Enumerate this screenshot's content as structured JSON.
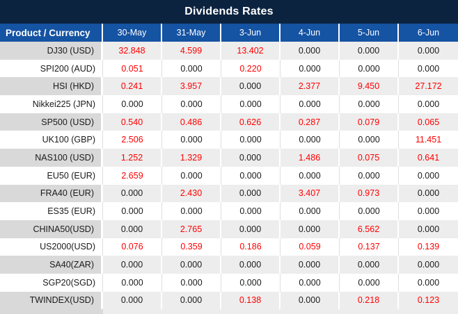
{
  "title": "Dividends Rates",
  "colors": {
    "title_bar_bg": "#0C2340",
    "header_bg": "#1553A3",
    "header_text": "#FFFFFF",
    "row_alt_product_bg": "#D9D9D9",
    "row_alt_value_bg": "#EDEDED",
    "row_white_bg": "#FFFFFF",
    "value_default": "#1A1A1A",
    "value_highlight": "#FF0000"
  },
  "table": {
    "product_column_header": "Product / Currency",
    "date_columns": [
      "30-May",
      "31-May",
      "3-Jun",
      "4-Jun",
      "5-Jun",
      "6-Jun"
    ],
    "rows": [
      {
        "product": "DJ30 (USD)",
        "values": [
          "32.848",
          "4.599",
          "13.402",
          "0.000",
          "0.000",
          "0.000"
        ],
        "highlight": [
          true,
          true,
          true,
          false,
          false,
          false
        ]
      },
      {
        "product": "SPI200 (AUD)",
        "values": [
          "0.051",
          "0.000",
          "0.220",
          "0.000",
          "0.000",
          "0.000"
        ],
        "highlight": [
          true,
          false,
          true,
          false,
          false,
          false
        ]
      },
      {
        "product": "HSI (HKD)",
        "values": [
          "0.241",
          "3.957",
          "0.000",
          "2.377",
          "9.450",
          "27.172"
        ],
        "highlight": [
          true,
          true,
          false,
          true,
          true,
          true
        ]
      },
      {
        "product": "Nikkei225 (JPN)",
        "values": [
          "0.000",
          "0.000",
          "0.000",
          "0.000",
          "0.000",
          "0.000"
        ],
        "highlight": [
          false,
          false,
          false,
          false,
          false,
          false
        ]
      },
      {
        "product": "SP500 (USD)",
        "values": [
          "0.540",
          "0.486",
          "0.626",
          "0.287",
          "0.079",
          "0.065"
        ],
        "highlight": [
          true,
          true,
          true,
          true,
          true,
          true
        ]
      },
      {
        "product": "UK100 (GBP)",
        "values": [
          "2.506",
          "0.000",
          "0.000",
          "0.000",
          "0.000",
          "11.451"
        ],
        "highlight": [
          true,
          false,
          false,
          false,
          false,
          true
        ]
      },
      {
        "product": "NAS100 (USD)",
        "values": [
          "1.252",
          "1.329",
          "0.000",
          "1.486",
          "0.075",
          "0.641"
        ],
        "highlight": [
          true,
          true,
          false,
          true,
          true,
          true
        ]
      },
      {
        "product": "EU50 (EUR)",
        "values": [
          "2.659",
          "0.000",
          "0.000",
          "0.000",
          "0.000",
          "0.000"
        ],
        "highlight": [
          true,
          false,
          false,
          false,
          false,
          false
        ]
      },
      {
        "product": "FRA40 (EUR)",
        "values": [
          "0.000",
          "2.430",
          "0.000",
          "3.407",
          "0.973",
          "0.000"
        ],
        "highlight": [
          false,
          true,
          false,
          true,
          true,
          false
        ]
      },
      {
        "product": "ES35 (EUR)",
        "values": [
          "0.000",
          "0.000",
          "0.000",
          "0.000",
          "0.000",
          "0.000"
        ],
        "highlight": [
          false,
          false,
          false,
          false,
          false,
          false
        ]
      },
      {
        "product": "CHINA50(USD)",
        "values": [
          "0.000",
          "2.765",
          "0.000",
          "0.000",
          "6.562",
          "0.000"
        ],
        "highlight": [
          false,
          true,
          false,
          false,
          true,
          false
        ]
      },
      {
        "product": "US2000(USD)",
        "values": [
          "0.076",
          "0.359",
          "0.186",
          "0.059",
          "0.137",
          "0.139"
        ],
        "highlight": [
          true,
          true,
          true,
          true,
          true,
          true
        ]
      },
      {
        "product": "SA40(ZAR)",
        "values": [
          "0.000",
          "0.000",
          "0.000",
          "0.000",
          "0.000",
          "0.000"
        ],
        "highlight": [
          false,
          false,
          false,
          false,
          false,
          false
        ]
      },
      {
        "product": "SGP20(SGD)",
        "values": [
          "0.000",
          "0.000",
          "0.000",
          "0.000",
          "0.000",
          "0.000"
        ],
        "highlight": [
          false,
          false,
          false,
          false,
          false,
          false
        ]
      },
      {
        "product": "TWINDEX(USD)",
        "values": [
          "0.000",
          "0.000",
          "0.138",
          "0.000",
          "0.218",
          "0.123"
        ],
        "highlight": [
          false,
          false,
          true,
          false,
          true,
          true
        ]
      }
    ]
  }
}
